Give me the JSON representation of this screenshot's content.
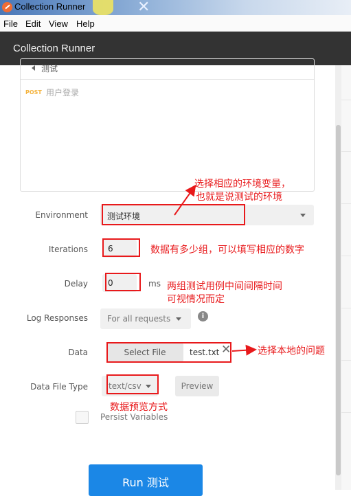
{
  "window": {
    "title": "Collection Runner"
  },
  "menu": [
    "File",
    "Edit",
    "View",
    "Help"
  ],
  "header": {
    "title": "Collection Runner"
  },
  "collection": {
    "name": "测试",
    "request_method": "POST",
    "request_name": "用户登录"
  },
  "form": {
    "environment": {
      "label": "Environment",
      "value": "测试环境"
    },
    "iterations": {
      "label": "Iterations",
      "value": "6"
    },
    "delay": {
      "label": "Delay",
      "value": "0",
      "unit": "ms"
    },
    "log_responses": {
      "label": "Log Responses",
      "value": "For all requests"
    },
    "data": {
      "label": "Data",
      "button": "Select File",
      "file": "test.txt",
      "clear": "✕"
    },
    "data_file_type": {
      "label": "Data File Type",
      "value": "text/csv",
      "preview": "Preview"
    },
    "persist": {
      "label": "Persist Variables",
      "checked": false
    }
  },
  "run_button": "Run 测试",
  "info_glyph": "i",
  "annotations": {
    "environment_line1": "选择相应的环境变量，",
    "environment_line2": "也就是说测试的环境",
    "iterations": "数据有多少组，可以填写相应的数字",
    "delay_line1": "两组测试用例中间间隔时间",
    "delay_line2": "可视情况而定",
    "data": "选择本地的问题",
    "data_file_type": "数据预览方式"
  },
  "colors": {
    "header_bg": "#333333",
    "run_button": "#1b87e6",
    "annotation": "#e8191b",
    "post_method": "#f4b33e"
  }
}
